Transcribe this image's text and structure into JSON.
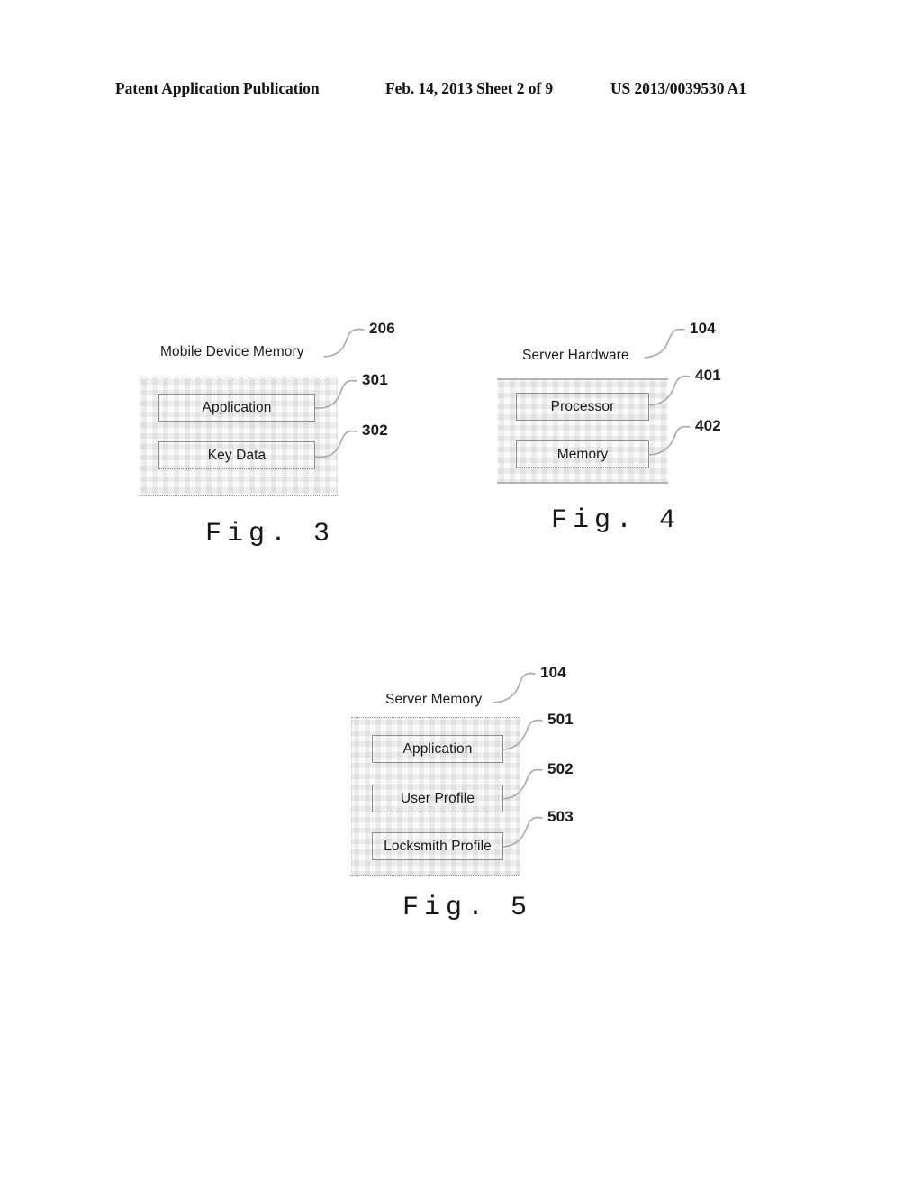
{
  "header": {
    "publication": "Patent Application Publication",
    "date_sheet": "Feb. 14, 2013   Sheet 2 of 9",
    "publication_number": "US 2013/0039530 A1"
  },
  "figures": [
    {
      "caption": "Fig. 3",
      "block_title": "Mobile Device Memory",
      "block_ref": "206",
      "items": [
        {
          "label": "Application",
          "ref": "301"
        },
        {
          "label": "Key Data",
          "ref": "302"
        }
      ]
    },
    {
      "caption": "Fig. 4",
      "block_title": "Server Hardware",
      "block_ref": "104",
      "items": [
        {
          "label": "Processor",
          "ref": "401"
        },
        {
          "label": "Memory",
          "ref": "402"
        }
      ]
    },
    {
      "caption": "Fig. 5",
      "block_title": "Server Memory",
      "block_ref": "104",
      "items": [
        {
          "label": "Application",
          "ref": "501"
        },
        {
          "label": "User Profile",
          "ref": "502"
        },
        {
          "label": "Locksmith Profile",
          "ref": "503"
        }
      ]
    }
  ],
  "colors": {
    "ink": "#171717",
    "line": "#8d8d8d",
    "leader": "#a8a8a8",
    "hatch": "#f0f0f0",
    "page": "#ffffff"
  }
}
